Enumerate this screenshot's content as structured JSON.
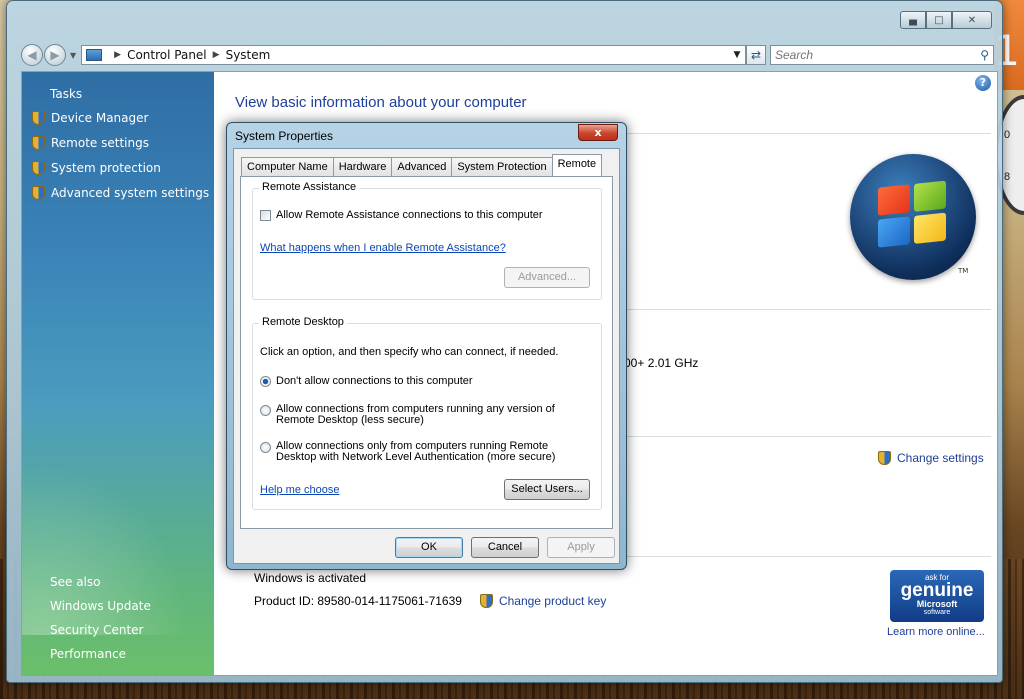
{
  "window": {
    "address": {
      "crumbs": [
        "Control Panel",
        "System"
      ]
    },
    "search": {
      "placeholder": "Search"
    }
  },
  "sidebar": {
    "tasks_title": "Tasks",
    "items": [
      {
        "label": "Device Manager"
      },
      {
        "label": "Remote settings"
      },
      {
        "label": "System protection"
      },
      {
        "label": "Advanced system settings"
      }
    ],
    "see_also_title": "See also",
    "see_also": [
      {
        "label": "Windows Update"
      },
      {
        "label": "Security Center"
      },
      {
        "label": "Performance"
      }
    ]
  },
  "main": {
    "title": "View basic information about your computer",
    "cpu_partial": "00+  2.01 GHz",
    "change_settings": "Change settings",
    "activation": "Windows is activated",
    "product_id": "Product ID: 89580-014-1175061-71639",
    "change_product_key": "Change product key",
    "genuine": {
      "line1": "ask for",
      "line2": "genuine",
      "line3": "Microsoft",
      "line4": "software"
    },
    "learn_more": "Learn more online...",
    "tm": "TM"
  },
  "dialog": {
    "title": "System Properties",
    "close": "x",
    "tabs": [
      {
        "label": "Computer Name",
        "active": false
      },
      {
        "label": "Hardware",
        "active": false
      },
      {
        "label": "Advanced",
        "active": false
      },
      {
        "label": "System Protection",
        "active": false
      },
      {
        "label": "Remote",
        "active": true
      }
    ],
    "remote_assistance": {
      "label": "Remote Assistance",
      "checkbox": "Allow Remote Assistance connections to this computer",
      "checked": false,
      "link": "What happens when I enable Remote Assistance?",
      "advanced_button": "Advanced..."
    },
    "remote_desktop": {
      "label": "Remote Desktop",
      "intro": "Click an option, and then specify who can connect, if needed.",
      "options": [
        {
          "line1": "Don't allow connections to this computer",
          "line2": "",
          "selected": true
        },
        {
          "line1": "Allow connections from computers running any version of",
          "line2": "Remote Desktop (less secure)",
          "selected": false
        },
        {
          "line1": "Allow connections only from computers running Remote",
          "line2": "Desktop with Network Level Authentication (more secure)",
          "selected": false
        }
      ],
      "help_link": "Help me choose",
      "select_users": "Select Users..."
    },
    "buttons": {
      "ok": "OK",
      "cancel": "Cancel",
      "apply": "Apply"
    }
  },
  "decor": {
    "orange_digit": "1",
    "clock_numbers": [
      "0",
      "8"
    ]
  },
  "colors": {
    "link": "#1e3f9a",
    "sidebar_top": "#2f6ea4",
    "sidebar_bottom": "#6bbf6a",
    "close_red": "#c9452b"
  }
}
